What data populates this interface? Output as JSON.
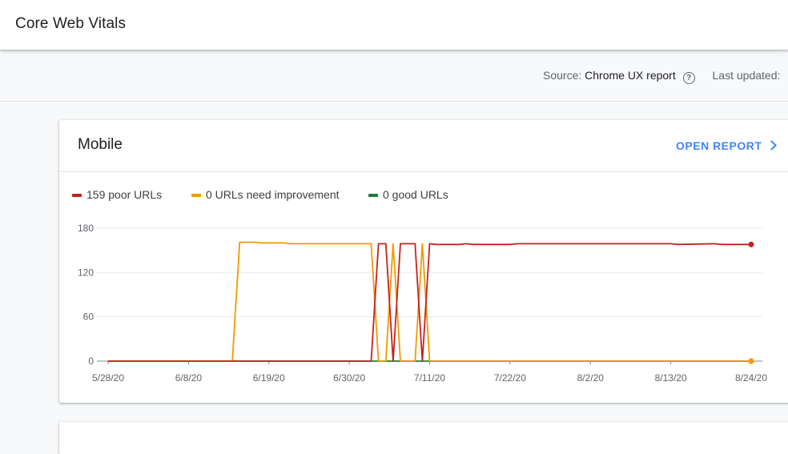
{
  "header": {
    "title": "Core Web Vitals"
  },
  "source_bar": {
    "source_label": "Source:",
    "source_value": "Chrome UX report",
    "help_icon": "help-circle-icon",
    "last_updated_label": "Last updated:"
  },
  "card": {
    "title": "Mobile",
    "open_report_label": "OPEN REPORT",
    "open_report_icon": "chevron-right-icon",
    "legend": [
      {
        "label": "159 poor URLs",
        "color": "#c5221f"
      },
      {
        "label": "0 URLs need improvement",
        "color": "#f29900"
      },
      {
        "label": "0 good URLs",
        "color": "#188038"
      }
    ]
  },
  "chart_data": {
    "type": "line",
    "title": "",
    "xlabel": "",
    "ylabel": "",
    "ylim": [
      0,
      180
    ],
    "yticks": [
      "0",
      "60",
      "120",
      "180"
    ],
    "xticks": [
      "5/28/20",
      "6/8/20",
      "6/19/20",
      "6/30/20",
      "7/11/20",
      "7/22/20",
      "8/2/20",
      "8/13/20",
      "8/24/20"
    ],
    "x_range": [
      "5/28/20",
      "8/24/20"
    ],
    "grid": true,
    "legend_position": "top-left",
    "series": [
      {
        "name": "159 poor URLs",
        "color": "#c5221f",
        "x": [
          "5/28/20",
          "7/3/20",
          "7/4/20",
          "7/5/20",
          "7/6/20",
          "7/7/20",
          "7/8/20",
          "7/9/20",
          "7/10/20",
          "7/11/20",
          "7/12/20",
          "7/15/20",
          "7/16/20",
          "7/17/20",
          "7/22/20",
          "7/23/20",
          "8/13/20",
          "8/14/20",
          "8/19/20",
          "8/20/20",
          "8/24/20"
        ],
        "y": [
          0,
          0,
          159,
          159,
          0,
          159,
          159,
          159,
          0,
          159,
          158,
          158,
          159,
          158,
          158,
          159,
          159,
          158,
          159,
          158,
          158
        ]
      },
      {
        "name": "0 URLs need improvement",
        "color": "#f29900",
        "x": [
          "5/28/20",
          "6/14/20",
          "6/15/20",
          "6/17/20",
          "6/18/20",
          "6/21/20",
          "6/22/20",
          "7/3/20",
          "7/4/20",
          "7/5/20",
          "7/6/20",
          "7/7/20",
          "7/8/20",
          "7/9/20",
          "7/10/20",
          "7/11/20",
          "8/24/20"
        ],
        "y": [
          0,
          0,
          161,
          161,
          160,
          160,
          159,
          159,
          0,
          0,
          159,
          0,
          0,
          0,
          159,
          0,
          0
        ]
      },
      {
        "name": "0 good URLs",
        "color": "#188038",
        "x": [
          "5/28/20",
          "8/24/20"
        ],
        "y": [
          0,
          0
        ]
      }
    ]
  }
}
